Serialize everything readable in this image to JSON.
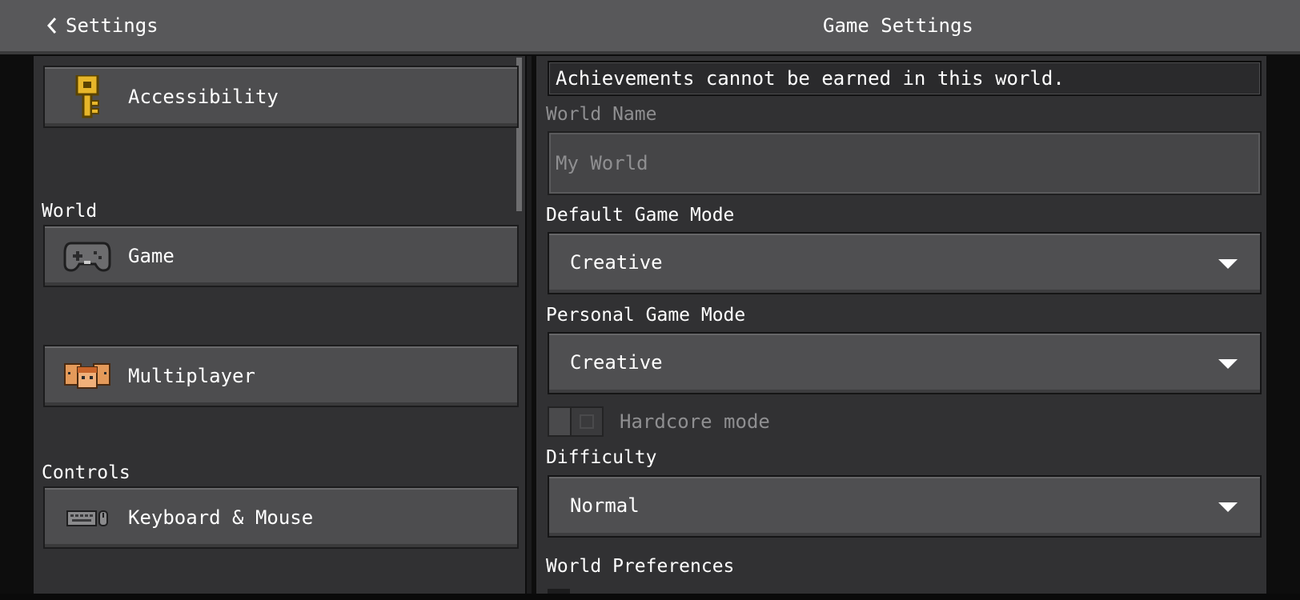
{
  "header": {
    "back_label": "Settings",
    "title": "Game Settings"
  },
  "sidebar": {
    "sections": [
      {
        "header": "",
        "items": [
          {
            "label": "Accessibility",
            "icon": "key-icon"
          }
        ]
      },
      {
        "header": "World",
        "items": [
          {
            "label": "Game",
            "icon": "controller-icon"
          },
          {
            "label": "Multiplayer",
            "icon": "players-icon"
          }
        ]
      },
      {
        "header": "Controls",
        "items": [
          {
            "label": "Keyboard & Mouse",
            "icon": "keyboard-mouse-icon"
          }
        ]
      }
    ]
  },
  "main": {
    "notice": "Achievements cannot be earned in this world.",
    "world_name": {
      "label": "World Name",
      "placeholder": "My World"
    },
    "default_game_mode": {
      "label": "Default Game Mode",
      "value": "Creative"
    },
    "personal_game_mode": {
      "label": "Personal Game Mode",
      "value": "Creative"
    },
    "hardcore": {
      "label": "Hardcore mode",
      "enabled": false
    },
    "difficulty": {
      "label": "Difficulty",
      "value": "Normal"
    },
    "world_preferences": {
      "label": "World Preferences"
    }
  },
  "colors": {
    "topbar": "#58585a",
    "panel": "#313133",
    "button": "#4d4d4f",
    "key_gold": "#e7b62a"
  }
}
